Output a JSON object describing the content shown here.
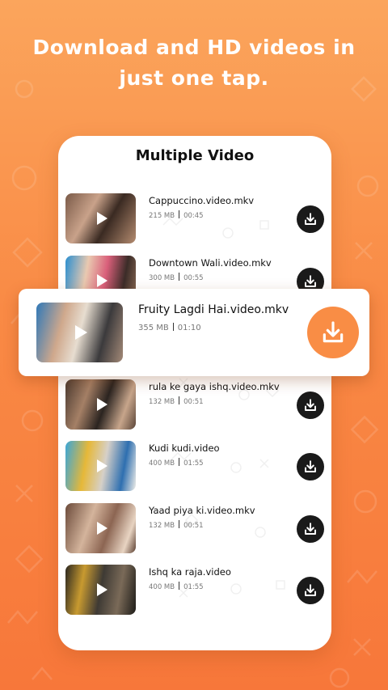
{
  "headline": {
    "line1": "Download and HD videos in",
    "line2": "just one tap."
  },
  "card": {
    "title": "Multiple Video"
  },
  "videos": [
    {
      "name": "Cappuccino.video.mkv",
      "size": "215 MB",
      "duration": "00:45"
    },
    {
      "name": "Downtown Wali.video.mkv",
      "size": "300 MB",
      "duration": "00:55"
    },
    {
      "name": "rula ke gaya ishq.video.mkv",
      "size": "132 MB",
      "duration": "00:51"
    },
    {
      "name": "Kudi kudi.video",
      "size": "400 MB",
      "duration": "01:55"
    },
    {
      "name": "Yaad piya ki.video.mkv",
      "size": "132 MB",
      "duration": "00:51"
    },
    {
      "name": "Ishq ka raja.video",
      "size": "400 MB",
      "duration": "01:55"
    }
  ],
  "featured": {
    "name": "Fruity Lagdi Hai.video.mkv",
    "size": "355 MB",
    "duration": "01:10"
  },
  "icons": {
    "play": "play-icon",
    "download": "download-icon"
  },
  "colors": {
    "accent": "#f98d45",
    "button_dark": "#1a1a1a"
  }
}
